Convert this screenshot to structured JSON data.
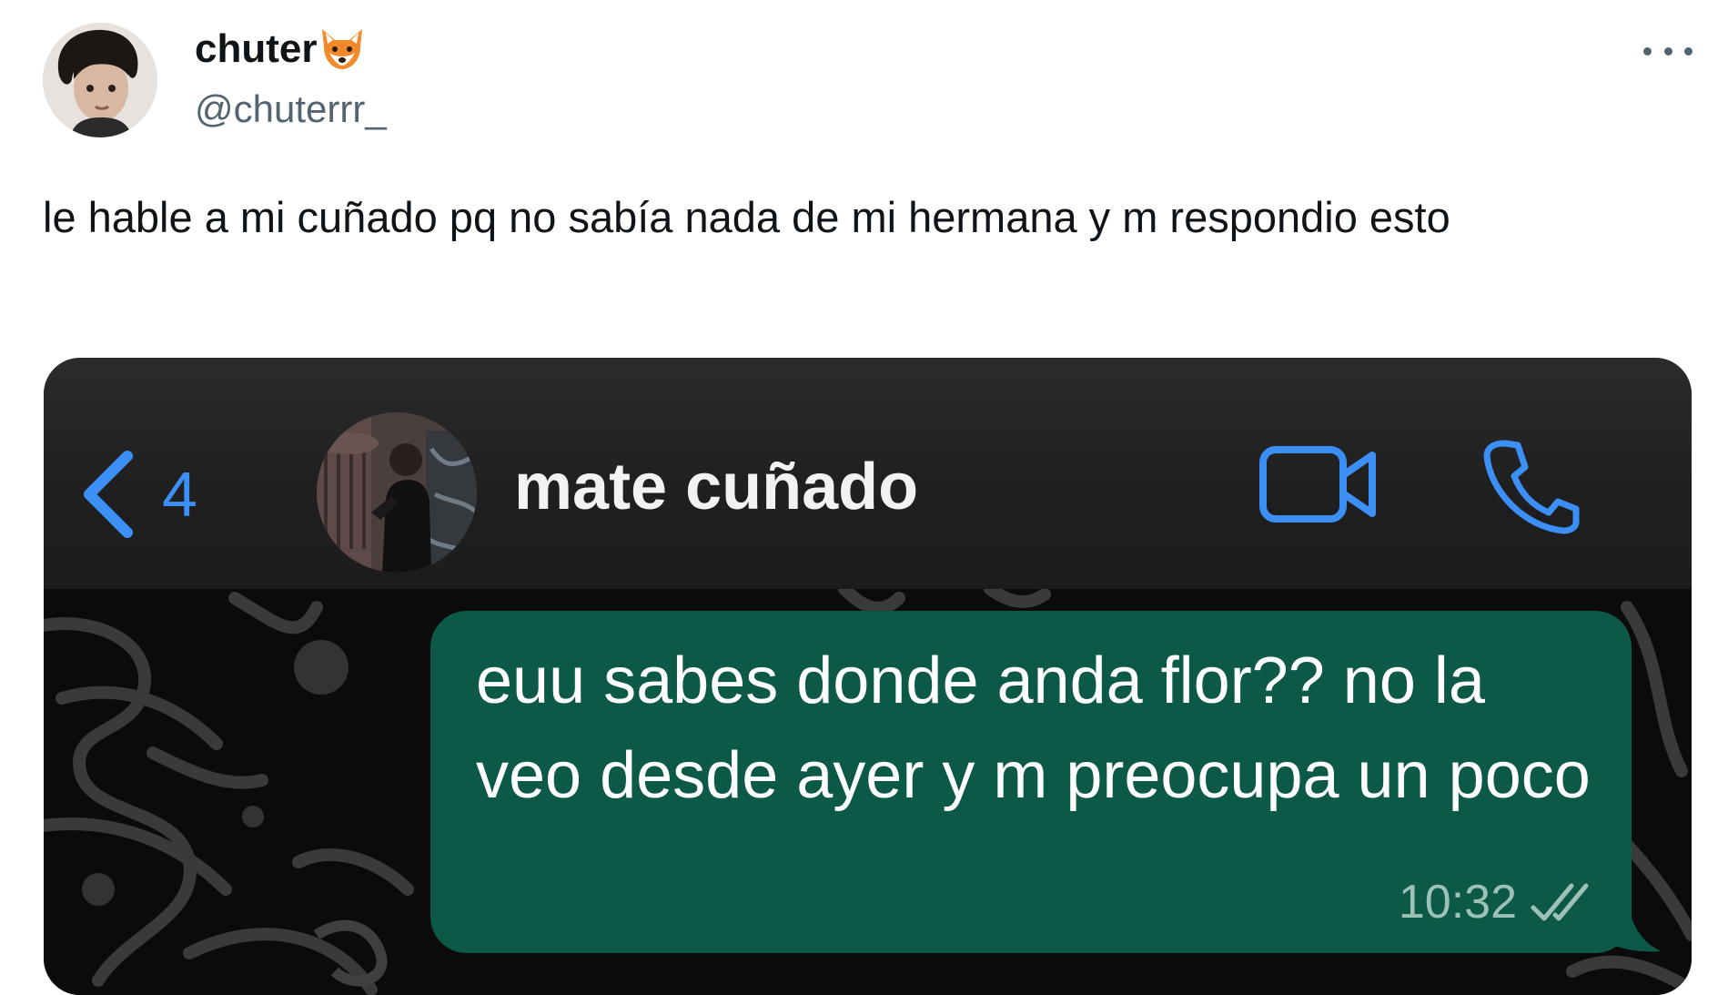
{
  "tweet": {
    "author": {
      "display_name": "chuter",
      "emoji": "fox-face-icon",
      "handle": "@chuterrr_"
    },
    "text": "le hable a mi cuñado pq no sabía nada de mi hermana y m respondio esto"
  },
  "screenshot": {
    "header": {
      "unread_count": "4",
      "contact_name": "mate cuñado"
    },
    "message": {
      "text": "euu sabes donde anda flor?? no la veo desde ayer y m preocupa un poco",
      "time": "10:32",
      "status_icon": "double-check-icon"
    }
  },
  "colors": {
    "ios_blue": "#3b8ff5",
    "bubble_green": "#0b5946",
    "text_dark": "#0f1419",
    "text_muted": "#536471"
  }
}
